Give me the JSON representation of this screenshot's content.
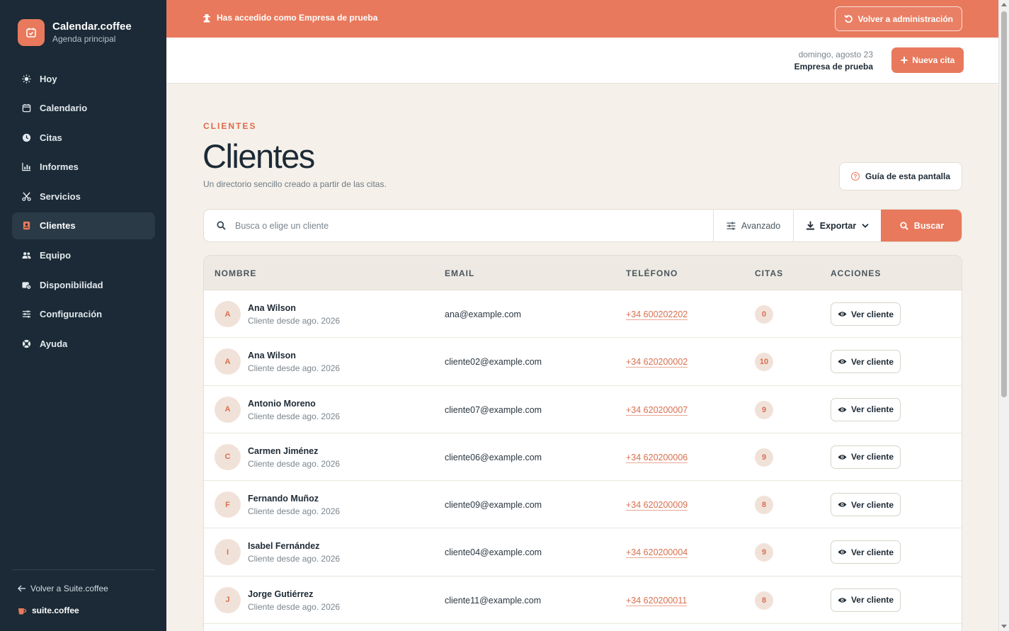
{
  "brand": {
    "name": "Calendar.coffee",
    "subtitle": "Agenda principal"
  },
  "sidebar": {
    "items": [
      {
        "label": "Hoy",
        "icon": "sun-icon",
        "active": false
      },
      {
        "label": "Calendario",
        "icon": "calendar-icon",
        "active": false
      },
      {
        "label": "Citas",
        "icon": "clock-icon",
        "active": false
      },
      {
        "label": "Informes",
        "icon": "chart-icon",
        "active": false
      },
      {
        "label": "Servicios",
        "icon": "scissors-icon",
        "active": false
      },
      {
        "label": "Clientes",
        "icon": "contacts-icon",
        "active": true
      },
      {
        "label": "Equipo",
        "icon": "users-icon",
        "active": false
      },
      {
        "label": "Disponibilidad",
        "icon": "calendar-clock-icon",
        "active": false
      },
      {
        "label": "Configuración",
        "icon": "sliders-icon",
        "active": false
      },
      {
        "label": "Ayuda",
        "icon": "lifebuoy-icon",
        "active": false
      }
    ],
    "back_link": "Volver a Suite.coffee",
    "suite_brand": "suite.coffee"
  },
  "banner": {
    "text": "Has accedido como Empresa de prueba",
    "back_button": "Volver a administración"
  },
  "header": {
    "date": "domingo, agosto 23",
    "company": "Empresa de prueba",
    "new_button": "Nueva cita"
  },
  "page": {
    "eyebrow": "CLIENTES",
    "title": "Clientes",
    "subtitle": "Un directorio sencillo creado a partir de las citas.",
    "guide_button": "Guía de esta pantalla"
  },
  "search": {
    "placeholder": "Busca o elige un cliente",
    "value": "",
    "advanced_label": "Avanzado",
    "export_label": "Exportar",
    "search_label": "Buscar"
  },
  "table": {
    "columns": [
      "NOMBRE",
      "EMAIL",
      "TELÉFONO",
      "CITAS",
      "ACCIONES"
    ],
    "action_label": "Ver cliente",
    "rows": [
      {
        "initial": "A",
        "name": "Ana Wilson",
        "since": "Cliente desde ago. 2026",
        "email": "ana@example.com",
        "phone": "+34 600202202",
        "count": "0"
      },
      {
        "initial": "A",
        "name": "Ana Wilson",
        "since": "Cliente desde ago. 2026",
        "email": "cliente02@example.com",
        "phone": "+34 620200002",
        "count": "10"
      },
      {
        "initial": "A",
        "name": "Antonio Moreno",
        "since": "Cliente desde ago. 2026",
        "email": "cliente07@example.com",
        "phone": "+34 620200007",
        "count": "9"
      },
      {
        "initial": "C",
        "name": "Carmen Jiménez",
        "since": "Cliente desde ago. 2026",
        "email": "cliente06@example.com",
        "phone": "+34 620200006",
        "count": "9"
      },
      {
        "initial": "F",
        "name": "Fernando Muñoz",
        "since": "Cliente desde ago. 2026",
        "email": "cliente09@example.com",
        "phone": "+34 620200009",
        "count": "8"
      },
      {
        "initial": "I",
        "name": "Isabel Fernández",
        "since": "Cliente desde ago. 2026",
        "email": "cliente04@example.com",
        "phone": "+34 620200004",
        "count": "9"
      },
      {
        "initial": "J",
        "name": "Jorge Gutiérrez",
        "since": "Cliente desde ago. 2026",
        "email": "cliente11@example.com",
        "phone": "+34 620200011",
        "count": "8"
      }
    ]
  },
  "colors": {
    "accent": "#e8795c",
    "sidebar_bg": "#1b2a36",
    "page_bg": "#f5f1ea"
  }
}
